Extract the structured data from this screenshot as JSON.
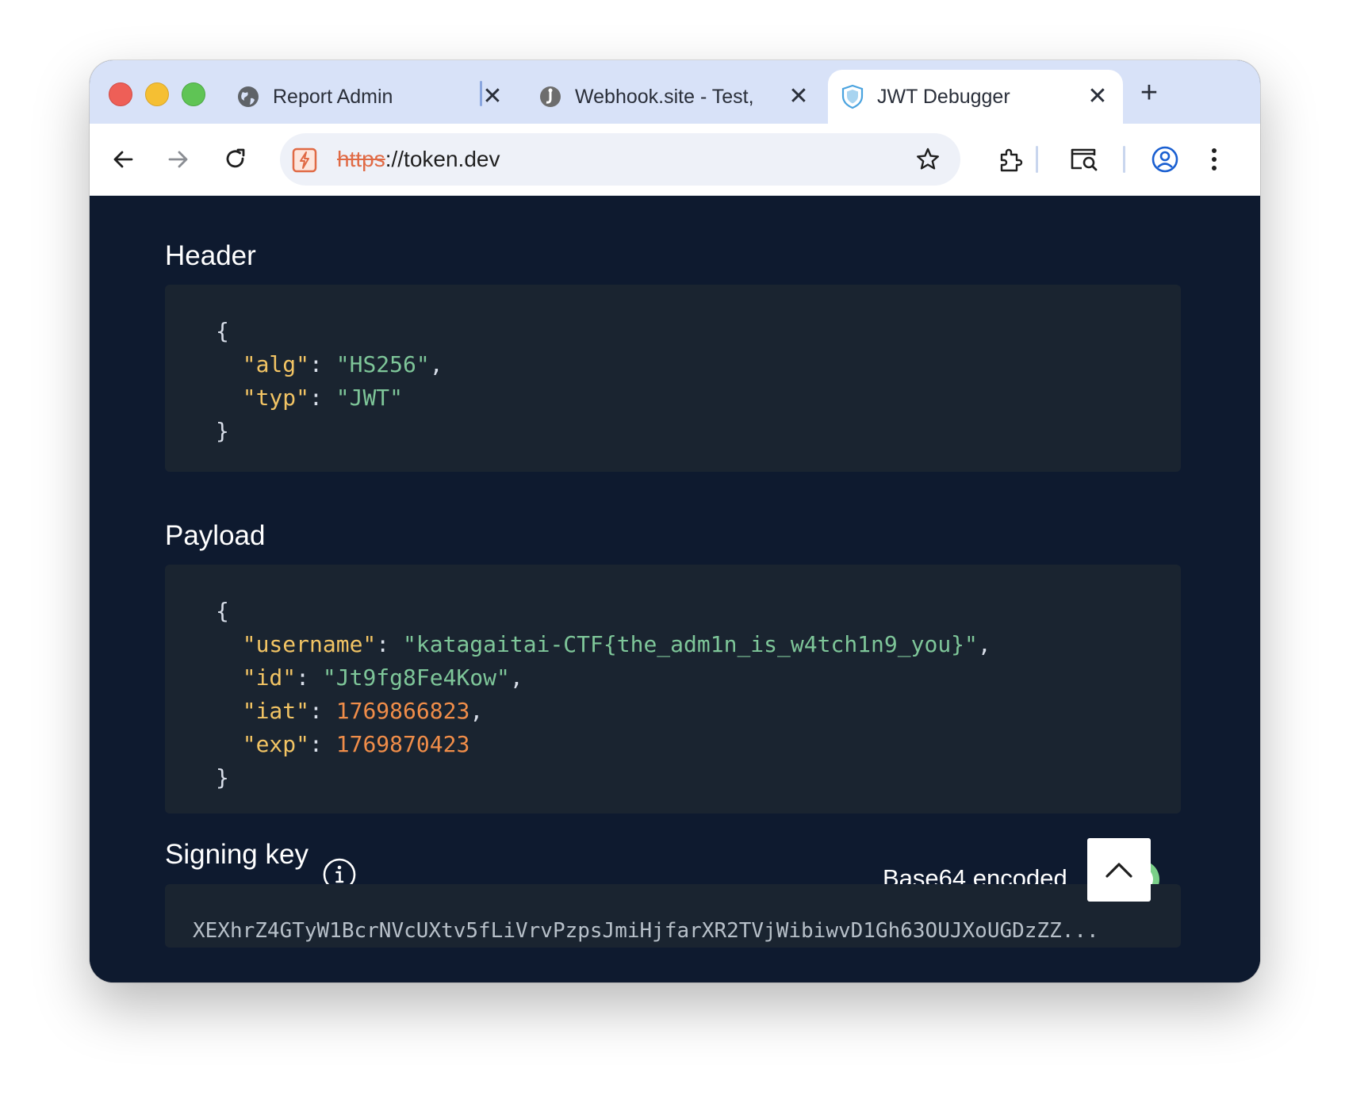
{
  "browser": {
    "tabs": [
      {
        "title": "Report Admin",
        "favicon": "globe-icon"
      },
      {
        "title": "Webhook.site - Test,",
        "favicon": "webhook-icon"
      },
      {
        "title": "JWT Debugger",
        "favicon": "shield-icon"
      }
    ],
    "close_glyph": "✕",
    "new_tab_glyph": "+",
    "url_scheme": "https",
    "url_rest": "://token.dev"
  },
  "sections": {
    "header": {
      "title": "Header",
      "json": {
        "alg": "HS256",
        "typ": "JWT"
      }
    },
    "payload": {
      "title": "Payload",
      "json": {
        "username": "katagaitai-CTF{the_adm1n_is_w4tch1n9_you}",
        "id": "Jt9fg8Fe4Kow",
        "iat": "1769866823",
        "exp": "1769870423"
      }
    },
    "signing_key": {
      "title": "Signing key",
      "base64_label": "Base64 encoded",
      "base64_enabled": true,
      "key_preview": "XEXhrZ4GTyW1BcrNVcUXtv5fLiVrvPzpsJmiHjfarXR2TVjWibiwvD1Gh63OUJXoUGDzZZ..."
    }
  },
  "colors": {
    "background": "#0e1a2f",
    "code_bg": "#1a2430",
    "json_key": "#f2c464",
    "json_string": "#7ec699",
    "json_number": "#f08d49",
    "toggle_on": "#7bd089"
  }
}
